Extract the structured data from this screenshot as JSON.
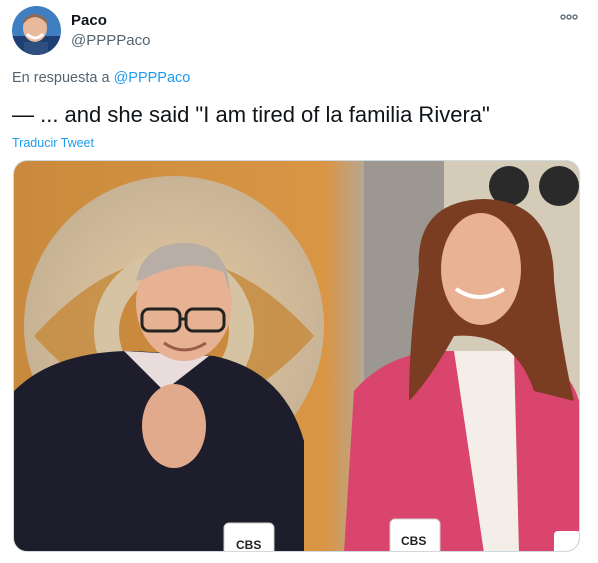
{
  "author": {
    "display_name": "Paco",
    "handle": "@PPPPaco"
  },
  "reply": {
    "prefix": "En respuesta a",
    "handle": "@PPPPaco"
  },
  "tweet": {
    "text": "— ... and she said \"I am tired of la familia Rivera\"",
    "translate_label": "Traducir Tweet"
  },
  "media": {
    "mug_left_text": "CBS",
    "mug_right_text": "CBS"
  },
  "icons": {
    "more": "more-options-icon"
  },
  "colors": {
    "link": "#1d9bf0",
    "secondary_text": "#536471",
    "primary_text": "#0f1419"
  }
}
